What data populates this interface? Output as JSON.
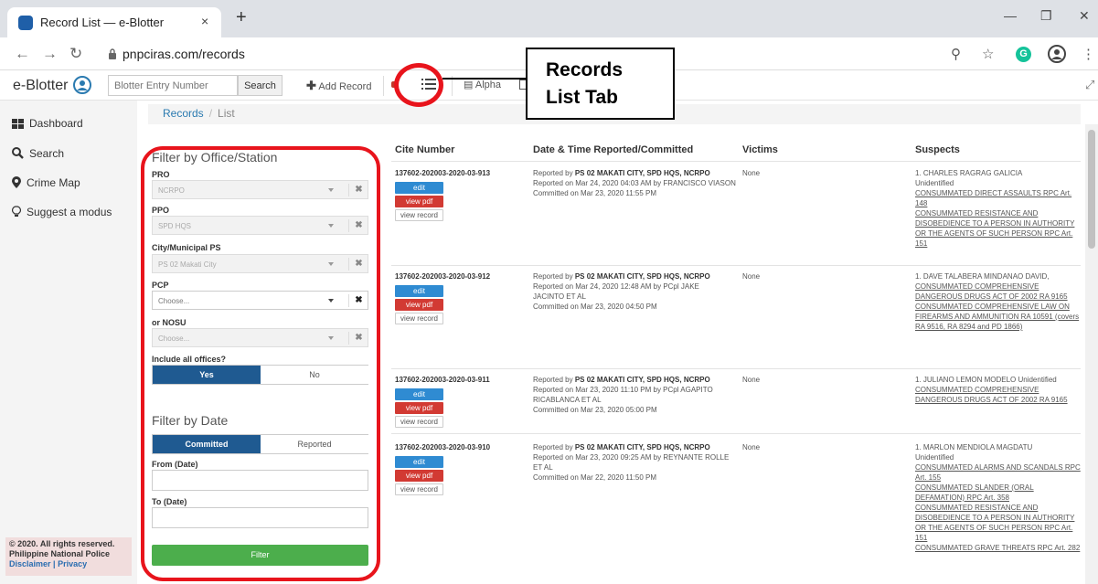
{
  "browser": {
    "tab_title": "Record List — e-Blotter",
    "tab_close": "×",
    "new_tab": "+",
    "url_host": "pnpciras.com",
    "url_path": "/records",
    "minimize": "—",
    "maximize": "❐",
    "close": "✕",
    "grammarly_letter": "G"
  },
  "appnav": {
    "brand": "e-Blotter",
    "search_placeholder": "Blotter Entry Number",
    "search_button": "Search",
    "add_record": "Add Record",
    "alpha": "Alpha"
  },
  "sidebar": {
    "items": [
      {
        "label": "Dashboard",
        "icon": "dashboard-icon"
      },
      {
        "label": "Search",
        "icon": "search-icon"
      },
      {
        "label": "Crime Map",
        "icon": "map-marker-icon"
      },
      {
        "label": "Suggest a modus",
        "icon": "lightbulb-icon"
      }
    ],
    "footer": {
      "copyright": "© 2020. All rights reserved.",
      "org": "Philippine National Police",
      "disclaimer": "Disclaimer",
      "sep": "|",
      "privacy": "Privacy"
    }
  },
  "breadcrumb": {
    "records": "Records",
    "sep": "/",
    "current": "List"
  },
  "filter": {
    "office_title": "Filter by Office/Station",
    "pro_label": "PRO",
    "pro_value": "NCRPO",
    "ppo_label": "PPO",
    "ppo_value": "SPD HQS",
    "city_label": "City/Municipal PS",
    "city_value": "PS 02 Makati City",
    "pcp_label": "PCP",
    "pcp_placeholder": "Choose...",
    "nosu_label": "or NOSU",
    "nosu_placeholder": "Choose...",
    "include_label": "Include all offices?",
    "yes": "Yes",
    "no": "No",
    "date_title": "Filter by Date",
    "committed": "Committed",
    "reported": "Reported",
    "from_label": "From (Date)",
    "to_label": "To (Date)",
    "filter_button": "Filter",
    "clear_glyph": "✖"
  },
  "table": {
    "headers": [
      "Cite Number",
      "Date & Time Reported/Committed",
      "Victims",
      "Suspects"
    ],
    "buttons": {
      "edit": "edit",
      "pdf": "view pdf",
      "view": "view record"
    },
    "rows": [
      {
        "cite": "137602-202003-2020-03-913",
        "reported_by_prefix": "Reported by",
        "reported_by_office": "PS 02 MAKATI CITY, SPD HQS, NCRPO",
        "reported_on": "Reported on Mar 24, 2020 04:03 AM by FRANCISCO VIASON",
        "committed_on": "Committed on Mar 23, 2020 11:55 PM",
        "victims": "None",
        "suspect_name": "1. CHARLES RAGRAG GALICIA",
        "suspect_status": "Unidentified",
        "offenses": [
          "CONSUMMATED DIRECT ASSAULTS RPC Art. 148",
          "CONSUMMATED RESISTANCE AND DISOBEDIENCE TO A PERSON IN AUTHORITY OR THE AGENTS OF SUCH PERSON RPC Art. 151"
        ]
      },
      {
        "cite": "137602-202003-2020-03-912",
        "reported_by_prefix": "Reported by",
        "reported_by_office": "PS 02 MAKATI CITY, SPD HQS, NCRPO",
        "reported_on": "Reported on Mar 24, 2020 12:48 AM by PCpl JAKE JACINTO ET AL",
        "committed_on": "Committed on Mar 23, 2020 04:50 PM",
        "victims": "None",
        "suspect_name": "1. DAVE TALABERA MINDANAO DAVID,",
        "suspect_status": "",
        "offenses": [
          "CONSUMMATED COMPREHENSIVE DANGEROUS DRUGS ACT OF 2002 RA 9165",
          "CONSUMMATED COMPREHENSIVE LAW ON FIREARMS AND AMMUNITION RA 10591 (covers RA 9516, RA 8294 and PD 1866)"
        ]
      },
      {
        "cite": "137602-202003-2020-03-911",
        "reported_by_prefix": "Reported by",
        "reported_by_office": "PS 02 MAKATI CITY, SPD HQS, NCRPO",
        "reported_on": "Reported on Mar 23, 2020 11:10 PM by PCpl AGAPITO RICABLANCA ET AL",
        "committed_on": "Committed on Mar 23, 2020 05:00 PM",
        "victims": "None",
        "suspect_name": "1. JULIANO LEMON MODELO Unidentified",
        "suspect_status": "",
        "offenses": [
          "CONSUMMATED COMPREHENSIVE DANGEROUS DRUGS ACT OF 2002 RA 9165"
        ]
      },
      {
        "cite": "137602-202003-2020-03-910",
        "reported_by_prefix": "Reported by",
        "reported_by_office": "PS 02 MAKATI CITY, SPD HQS, NCRPO",
        "reported_on": "Reported on Mar 23, 2020 09:25 AM by REYNANTE ROLLE ET AL",
        "committed_on": "Committed on Mar 22, 2020 11:50 PM",
        "victims": "None",
        "suspect_name": "1. MARLON MENDIOLA MAGDATU",
        "suspect_status": "Unidentified",
        "offenses": [
          "CONSUMMATED ALARMS AND SCANDALS RPC Art. 155",
          "CONSUMMATED SLANDER (ORAL DEFAMATION) RPC Art. 358",
          "CONSUMMATED RESISTANCE AND DISOBEDIENCE TO A PERSON IN AUTHORITY OR THE AGENTS OF SUCH PERSON RPC Art. 151",
          "CONSUMMATED GRAVE THREATS RPC Art. 282"
        ]
      }
    ]
  },
  "annotation": {
    "line1": "Records",
    "line2": "List Tab"
  },
  "colors": {
    "annotation_red": "#e8141c",
    "toggle_active": "#1f5a91",
    "filter_green": "#4cae4c",
    "edit_blue": "#2f8bd2",
    "pdf_red": "#d23a33"
  }
}
